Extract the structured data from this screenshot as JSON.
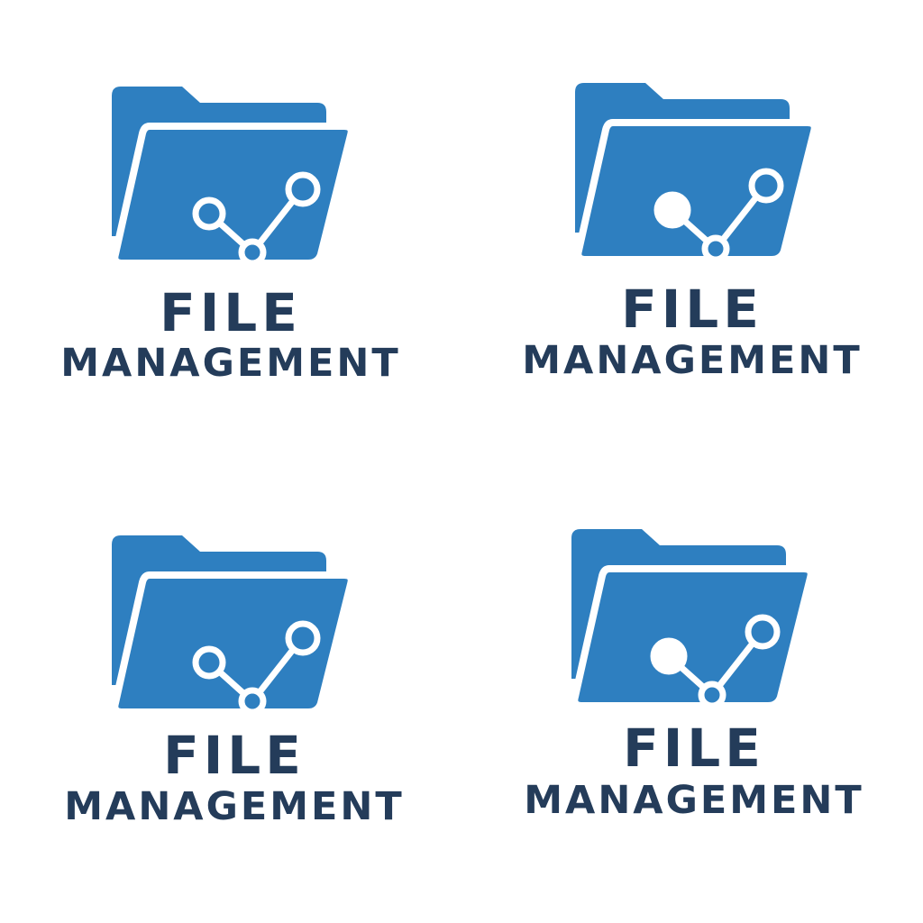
{
  "colors": {
    "folder": "#2e7fc0",
    "text": "#243c5a",
    "background": "#ffffff"
  },
  "logos": [
    {
      "title": "FILE",
      "subtitle": "MANAGEMENT",
      "icon": "folder-share-icon",
      "left_node": "ring"
    },
    {
      "title": "FILE",
      "subtitle": "MANAGEMENT",
      "icon": "folder-share-icon",
      "left_node": "filled"
    },
    {
      "title": "FILE",
      "subtitle": "MANAGEMENT",
      "icon": "folder-share-icon",
      "left_node": "ring"
    },
    {
      "title": "FILE",
      "subtitle": "MANAGEMENT",
      "icon": "folder-share-icon",
      "left_node": "filled"
    }
  ]
}
